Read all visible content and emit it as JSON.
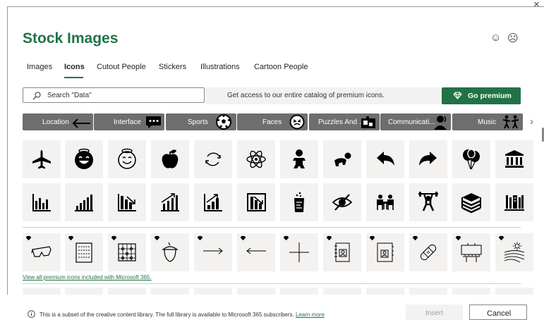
{
  "dialog": {
    "title": "Stock Images",
    "close_glyph": "×",
    "smile_glyph": "☺",
    "frown_glyph": "☹"
  },
  "tabs": [
    {
      "label": "Images"
    },
    {
      "label": "Icons",
      "active": true
    },
    {
      "label": "Cutout People"
    },
    {
      "label": "Stickers"
    },
    {
      "label": "Illustrations"
    },
    {
      "label": "Cartoon People"
    }
  ],
  "search": {
    "placeholder": "Search \"Data\""
  },
  "promo": {
    "text": "Get access to our entire catalog of premium icons.",
    "button_label": "Go premium"
  },
  "categories": [
    {
      "label": "Location",
      "icon": "arrow-left-icon"
    },
    {
      "label": "Interface",
      "icon": "chat-icon"
    },
    {
      "label": "Sports",
      "icon": "soccer-ball-icon"
    },
    {
      "label": "Faces",
      "icon": "face-icon"
    },
    {
      "label": "Puzzles And ...",
      "icon": "puzzle-icon"
    },
    {
      "label": "Communicati...",
      "icon": "person-talking-icon"
    },
    {
      "label": "Music",
      "icon": "dancers-icon"
    }
  ],
  "row1_icons": [
    "airplane-icon",
    "smiling-face-icon",
    "angel-face-icon",
    "apple-icon",
    "refresh-icon",
    "atom-icon",
    "baby-icon",
    "crawling-baby-icon",
    "reply-icon",
    "forward-icon",
    "balloons-icon",
    "bank-icon"
  ],
  "row2_icons": [
    "bar-chart-icon",
    "bar-chart-growth-icon",
    "bar-chart-down-icon",
    "bar-chart-up-icon",
    "bar-chart-rising-icon",
    "bar-chart-falling-icon",
    "beaker-icon",
    "eye-hidden-icon",
    "meeting-icon",
    "weightlifter-icon",
    "books-icon",
    "library-icon"
  ],
  "row3_icons": [
    "glasses-3d-icon",
    "binary-tablet-icon",
    "abacus-icon",
    "acorn-icon",
    "arrow-right-thin-icon",
    "arrow-left-thin-icon",
    "plus-thin-icon",
    "contact-card-icon",
    "address-book-icon",
    "bandage-icon",
    "billboard-icon",
    "farm-field-icon"
  ],
  "view_all_link": "View all premium icons included with Microsoft 365.",
  "footer": {
    "info_text": "This is a subset of the creative content library. The full library is available to Microsoft 365 subscribers.",
    "learn_more": "Learn more",
    "insert_label": "Insert",
    "cancel_label": "Cancel"
  },
  "colors": {
    "accent": "#217346",
    "pill": "#6e6e6e",
    "tile": "#f3f2f1"
  }
}
